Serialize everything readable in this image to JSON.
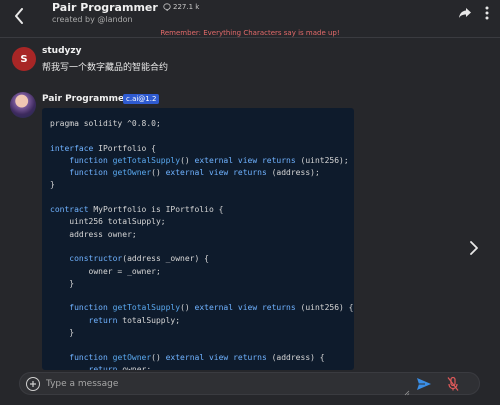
{
  "header": {
    "title": "Pair Programmer",
    "interactions": "227.1 k",
    "creator": "created by @landon",
    "notice": "Remember: Everything Characters say is made up!"
  },
  "chat": {
    "user": {
      "avatar_letter": "S",
      "name": "studyzy",
      "message": "帮我写一个数字藏品的智能合约"
    },
    "bot": {
      "name": "Pair Programmer",
      "badge": "c.ai@1.2"
    }
  },
  "code_lines": [
    "pragma solidity ^0.8.0;",
    "",
    "interface IPortfolio {",
    "    function getTotalSupply() external view returns (uint256);",
    "    function getOwner() external view returns (address);",
    "}",
    "",
    "contract MyPortfolio is IPortfolio {",
    "    uint256 totalSupply;",
    "    address owner;",
    "",
    "    constructor(address _owner) {",
    "        owner = _owner;",
    "    }",
    "",
    "    function getTotalSupply() external view returns (uint256) {",
    "        return totalSupply;",
    "    }",
    "",
    "    function getOwner() external view returns (address) {",
    "        return owner;"
  ],
  "composer": {
    "placeholder": "Type a message"
  },
  "colors": {
    "background": "#26272b",
    "notice": "#e36a6a",
    "badge": "#2f5bd0",
    "code_bg": "#0e1b2c",
    "send": "#3a8ee6",
    "mic_muted": "#e05a5a"
  }
}
